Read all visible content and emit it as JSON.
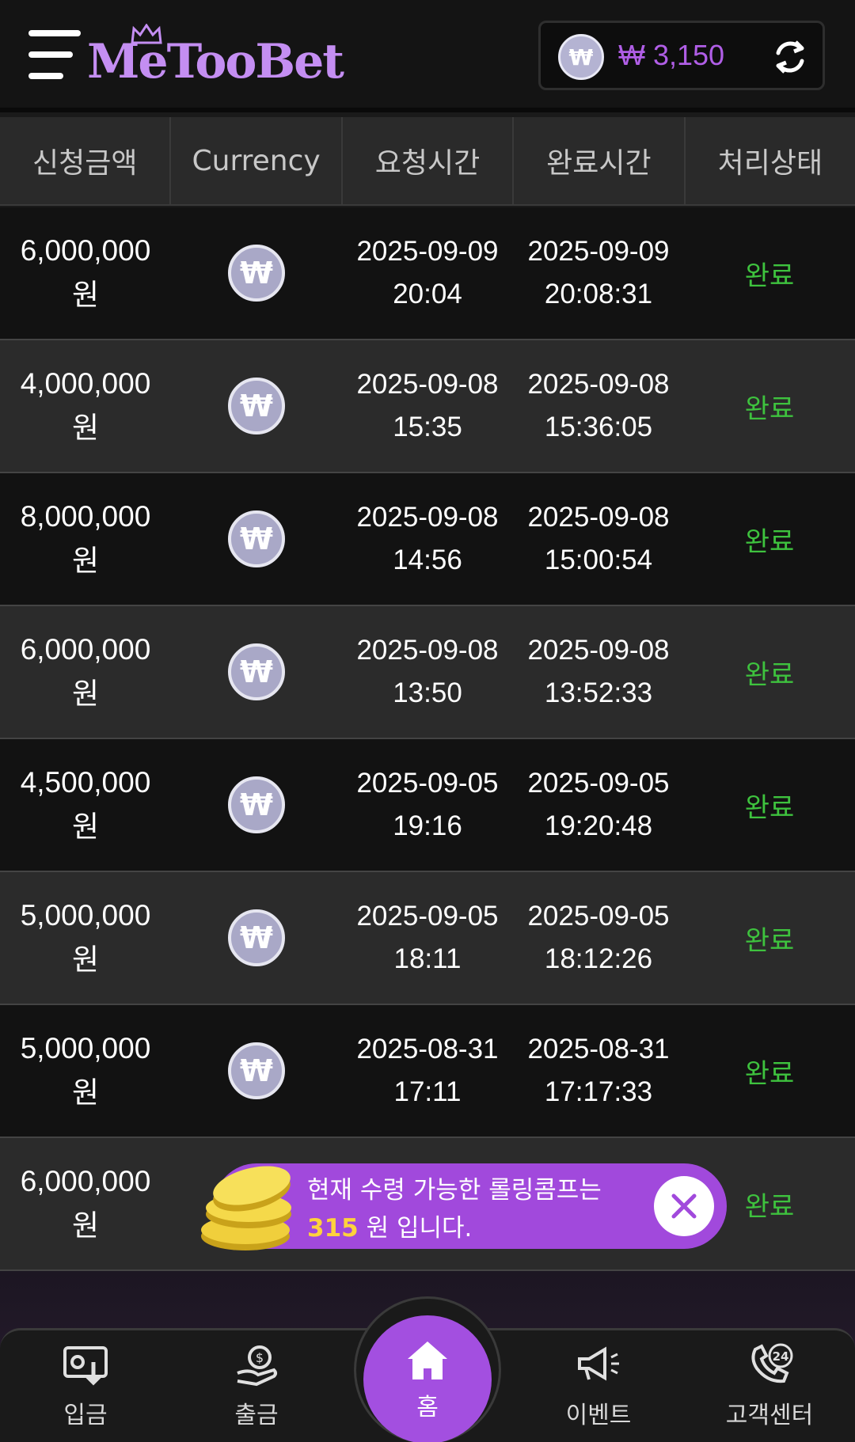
{
  "header": {
    "logo": "MeTooBet",
    "balance": "₩ 3,150",
    "currency_symbol": "₩"
  },
  "table": {
    "columns": [
      "신청금액",
      "Currency",
      "요청시간",
      "완료시간",
      "처리상태"
    ],
    "rows": [
      {
        "amount": "6,000,000",
        "unit": "원",
        "req_date": "2025-09-09",
        "req_time": "20:04",
        "done_date": "2025-09-09",
        "done_time": "20:08:31",
        "status": "완료"
      },
      {
        "amount": "4,000,000",
        "unit": "원",
        "req_date": "2025-09-08",
        "req_time": "15:35",
        "done_date": "2025-09-08",
        "done_time": "15:36:05",
        "status": "완료"
      },
      {
        "amount": "8,000,000",
        "unit": "원",
        "req_date": "2025-09-08",
        "req_time": "14:56",
        "done_date": "2025-09-08",
        "done_time": "15:00:54",
        "status": "완료"
      },
      {
        "amount": "6,000,000",
        "unit": "원",
        "req_date": "2025-09-08",
        "req_time": "13:50",
        "done_date": "2025-09-08",
        "done_time": "13:52:33",
        "status": "완료"
      },
      {
        "amount": "4,500,000",
        "unit": "원",
        "req_date": "2025-09-05",
        "req_time": "19:16",
        "done_date": "2025-09-05",
        "done_time": "19:20:48",
        "status": "완료"
      },
      {
        "amount": "5,000,000",
        "unit": "원",
        "req_date": "2025-09-05",
        "req_time": "18:11",
        "done_date": "2025-09-05",
        "done_time": "18:12:26",
        "status": "완료"
      },
      {
        "amount": "5,000,000",
        "unit": "원",
        "req_date": "2025-08-31",
        "req_time": "17:11",
        "done_date": "2025-08-31",
        "done_time": "17:17:33",
        "status": "완료"
      },
      {
        "amount": "6,000,000",
        "unit": "원",
        "status": "완료"
      }
    ]
  },
  "toast": {
    "line1": "현재 수령 가능한 롤링콤프는",
    "amount": "315",
    "line2_suffix": " 원 입니다."
  },
  "nav": {
    "items": [
      {
        "label": "입금",
        "icon": "deposit-icon"
      },
      {
        "label": "출금",
        "icon": "withdraw-icon"
      },
      {
        "label": "홈",
        "icon": "home-icon"
      },
      {
        "label": "이벤트",
        "icon": "megaphone-icon"
      },
      {
        "label": "고객센터",
        "icon": "support-24-icon"
      }
    ]
  },
  "colors": {
    "accent": "#a34fe0",
    "status_green": "#3ec23e",
    "balance": "#b05ee6"
  }
}
